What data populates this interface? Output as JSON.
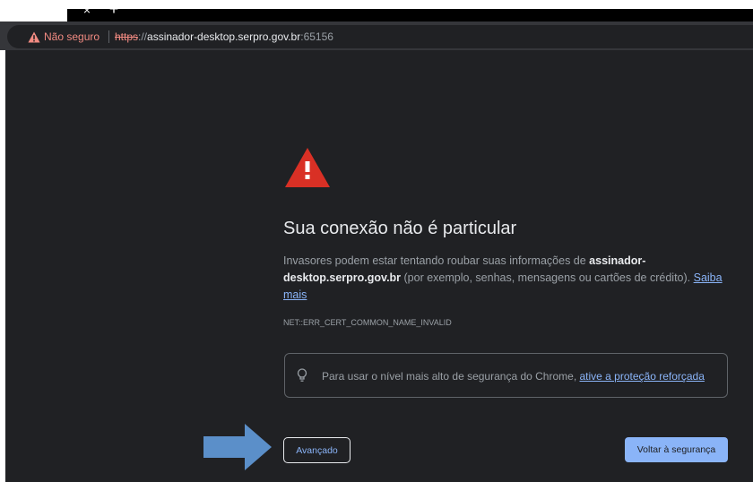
{
  "browser": {
    "tab_close_glyph": "×",
    "new_tab_glyph": "+",
    "security_label": "Não seguro",
    "url": {
      "scheme": "https",
      "slashes": "://",
      "host": "assinador-desktop.serpro.gov.br",
      "port": ":65156"
    }
  },
  "interstitial": {
    "heading": "Sua conexão não é particular",
    "desc_before": "Invasores podem estar tentando roubar suas informações de ",
    "desc_host": "assinador-desktop.serpro.gov.br",
    "desc_after": " (por exemplo, senhas, mensagens ou cartões de crédito). ",
    "learn_more": "Saiba mais",
    "error_code": "NET::ERR_CERT_COMMON_NAME_INVALID",
    "promo_text": "Para usar o nível mais alto de segurança do Chrome, ",
    "promo_link": "ative a proteção reforçada",
    "advanced_button": "Avançado",
    "back_button": "Voltar à segurança"
  },
  "colors": {
    "page_bg": "#202124",
    "warning_red": "#d93025",
    "link_blue": "#8ab4f8",
    "annotation_arrow": "#5b8fc9"
  },
  "icons": [
    "warning-icon",
    "lightbulb-icon",
    "arrow-annotation"
  ]
}
